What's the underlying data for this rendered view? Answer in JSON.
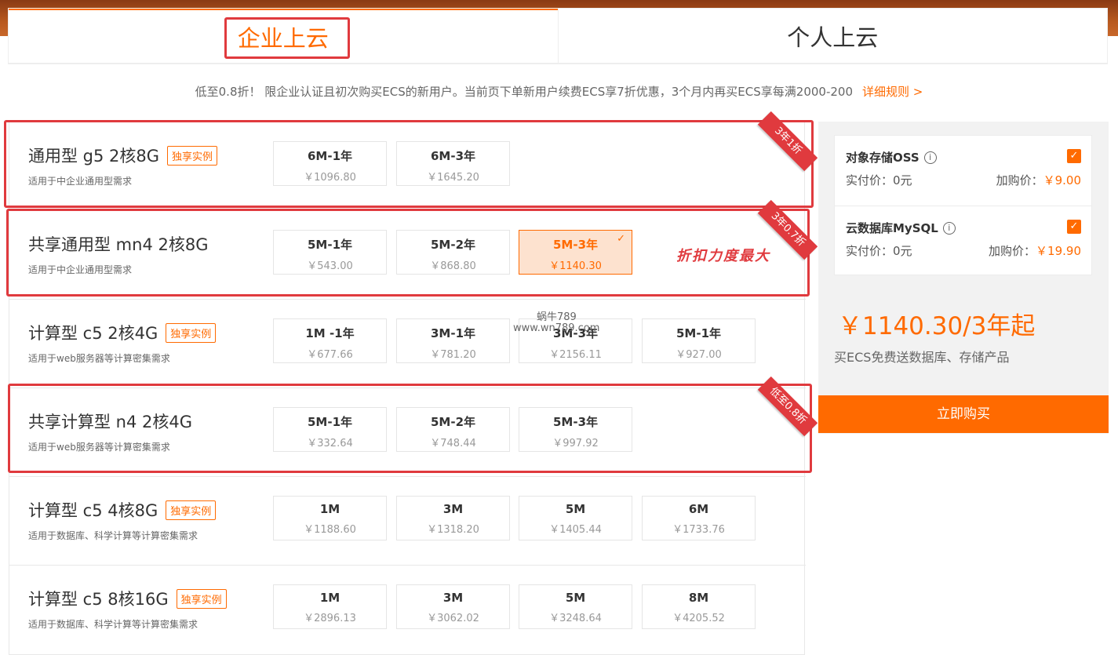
{
  "tabs": [
    {
      "label": "企业上云"
    },
    {
      "label": "个人上云"
    }
  ],
  "promo": {
    "text": "低至0.8折！ 限企业认证且初次购买ECS的新用户。当前页下单新用户续费ECS享7折优惠，3个月内再买ECS享每满2000-200",
    "link": "详细规则 >"
  },
  "products": [
    {
      "title": "通用型 g5 2核8G",
      "badge": "独享实例",
      "desc": "适用于中企业通用型需求",
      "ribbon": "3年1折",
      "options": [
        {
          "label": "6M-1年",
          "price": "￥1096.80"
        },
        {
          "label": "6M-3年",
          "price": "￥1645.20"
        }
      ]
    },
    {
      "title": "共享通用型 mn4 2核8G",
      "badge": "",
      "desc": "适用于中企业通用型需求",
      "ribbon": "3年0.7折",
      "options": [
        {
          "label": "5M-1年",
          "price": "￥543.00"
        },
        {
          "label": "5M-2年",
          "price": "￥868.80"
        },
        {
          "label": "5M-3年",
          "price": "￥1140.30",
          "selected": true
        }
      ]
    },
    {
      "title": "计算型 c5 2核4G",
      "badge": "独享实例",
      "desc": "适用于web服务器等计算密集需求",
      "ribbon": "",
      "options": [
        {
          "label": "1M -1年",
          "price": "￥677.66"
        },
        {
          "label": "3M-1年",
          "price": "￥781.20"
        },
        {
          "label": "3M-3年",
          "price": "￥2156.11"
        },
        {
          "label": "5M-1年",
          "price": "￥927.00"
        }
      ]
    },
    {
      "title": "共享计算型 n4 2核4G",
      "badge": "",
      "desc": "适用于web服务器等计算密集需求",
      "ribbon": "低至0.8折",
      "options": [
        {
          "label": "5M-1年",
          "price": "￥332.64"
        },
        {
          "label": "5M-2年",
          "price": "￥748.44"
        },
        {
          "label": "5M-3年",
          "price": "￥997.92"
        }
      ]
    },
    {
      "title": "计算型 c5 4核8G",
      "badge": "独享实例",
      "desc": "适用于数据库、科学计算等计算密集需求",
      "ribbon": "",
      "options": [
        {
          "label": "1M",
          "price": "￥1188.60"
        },
        {
          "label": "3M",
          "price": "￥1318.20"
        },
        {
          "label": "5M",
          "price": "￥1405.44"
        },
        {
          "label": "6M",
          "price": "￥1733.76"
        }
      ]
    },
    {
      "title": "计算型 c5 8核16G",
      "badge": "独享实例",
      "desc": "适用于数据库、科学计算等计算密集需求",
      "ribbon": "",
      "options": [
        {
          "label": "1M",
          "price": "￥2896.13"
        },
        {
          "label": "3M",
          "price": "￥3062.02"
        },
        {
          "label": "5M",
          "price": "￥3248.64"
        },
        {
          "label": "8M",
          "price": "￥4205.52"
        }
      ]
    }
  ],
  "annotation": "折扣力度最大",
  "watermark": {
    "line1": "蜗牛789",
    "line2": "www.wn789.com"
  },
  "side": {
    "addons": [
      {
        "name": "对象存储OSS",
        "pay_label": "实付价：0元",
        "buy_label": "加购价：",
        "buy_value": "￥9.00",
        "checked": true
      },
      {
        "name": "云数据库MySQL",
        "pay_label": "实付价：0元",
        "buy_label": "加购价：",
        "buy_value": "￥19.90",
        "checked": true
      }
    ],
    "total": "￥1140.30/3年起",
    "total_sub": "买ECS免费送数据库、存储产品",
    "buy_button": "立即购买"
  },
  "colors": {
    "accent": "#ff6a00",
    "highlight": "#e03a3e"
  }
}
